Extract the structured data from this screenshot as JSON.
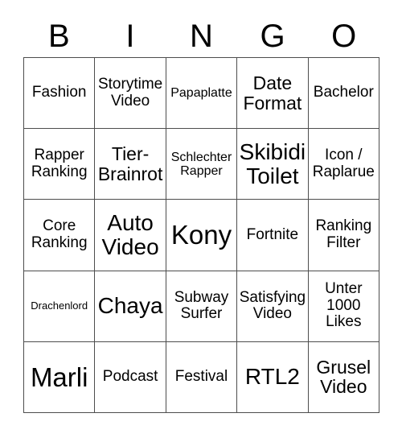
{
  "card": {
    "headers": [
      "B",
      "I",
      "N",
      "G",
      "O"
    ],
    "rows": [
      [
        {
          "text": "Fashion",
          "size": "md"
        },
        {
          "text": "Storytime Video",
          "size": "md"
        },
        {
          "text": "Papaplatte",
          "size": "sm"
        },
        {
          "text": "Date Format",
          "size": "lg"
        },
        {
          "text": "Bachelor",
          "size": "md"
        }
      ],
      [
        {
          "text": "Rapper Ranking",
          "size": "md"
        },
        {
          "text": "Tier-Brainrot",
          "size": "lg"
        },
        {
          "text": "Schlechter Rapper",
          "size": "sm"
        },
        {
          "text": "Skibidi Toilet",
          "size": "xl"
        },
        {
          "text": "Icon / Raplarue",
          "size": "md"
        }
      ],
      [
        {
          "text": "Core Ranking",
          "size": "md"
        },
        {
          "text": "Auto Video",
          "size": "xl"
        },
        {
          "text": "Kony",
          "size": "xxl"
        },
        {
          "text": "Fortnite",
          "size": "md"
        },
        {
          "text": "Ranking Filter",
          "size": "md"
        }
      ],
      [
        {
          "text": "Drachenlord",
          "size": "xs"
        },
        {
          "text": "Chaya",
          "size": "xl"
        },
        {
          "text": "Subway Surfer",
          "size": "md"
        },
        {
          "text": "Satisfying Video",
          "size": "md"
        },
        {
          "text": "Unter 1000 Likes",
          "size": "md"
        }
      ],
      [
        {
          "text": "Marli",
          "size": "xxl"
        },
        {
          "text": "Podcast",
          "size": "md"
        },
        {
          "text": "Festival",
          "size": "md"
        },
        {
          "text": "RTL2",
          "size": "xl"
        },
        {
          "text": "Grusel Video",
          "size": "lg"
        }
      ]
    ]
  },
  "colors": {
    "background": "#ffffff",
    "text": "#000000",
    "grid_line": "#4d4d4d"
  }
}
